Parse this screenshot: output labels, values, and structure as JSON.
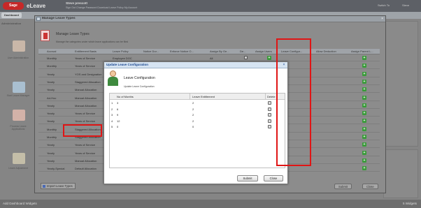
{
  "app": {
    "logo_text": "Sage",
    "brand": "eLeave",
    "user_name": "Steve prescott",
    "user_links": "Sign Out   Change Password   Download Leave Policy   My Account",
    "top_right_left": "Switch To",
    "top_right_right": "Steve"
  },
  "nav": {
    "dashboard": "Dashboard"
  },
  "sidebar": {
    "heading": "Administration",
    "items": [
      {
        "label": "User Administration"
      },
      {
        "label": "Start Leave Manager"
      },
      {
        "label": "Process Leave Applications"
      },
      {
        "label": "Leave Adjustment"
      }
    ]
  },
  "window": {
    "title": "Manage Leave Types",
    "heading": "Manage Leave Types",
    "subtitle": "Manage the categories under which leave applications can be filed",
    "columns": [
      "Accrual",
      "Entitlement Basis",
      "Leave Policy",
      "Notice Dur...",
      "Enforce Notice O...",
      "Assign By Ge...",
      "De...",
      "Assign Users",
      "Leave Configur...",
      "Allow Deduction",
      "Assign Parent L..."
    ],
    "rows": [
      {
        "accrual": "Monthly",
        "basis": "Years of Service",
        "policy": "Employee DOC",
        "gender": "All"
      },
      {
        "accrual": "Monthly",
        "basis": "Years of Service",
        "policy": "",
        "gender": ""
      },
      {
        "accrual": "Yearly",
        "basis": "YOS and Designation",
        "policy": "",
        "gender": ""
      },
      {
        "accrual": "Yearly",
        "basis": "Staggered Allocation",
        "policy": "",
        "gender": ""
      },
      {
        "accrual": "Yearly",
        "basis": "Manual Allocation",
        "policy": "",
        "gender": ""
      },
      {
        "accrual": "Ad-Hoc",
        "basis": "Manual Allocation",
        "policy": "",
        "gender": ""
      },
      {
        "accrual": "Yearly",
        "basis": "Manual Allocation",
        "policy": "",
        "gender": ""
      },
      {
        "accrual": "Yearly",
        "basis": "Years of Service",
        "policy": "",
        "gender": ""
      },
      {
        "accrual": "Yearly",
        "basis": "Years of Service",
        "policy": "",
        "gender": ""
      },
      {
        "accrual": "Monthly",
        "basis": "Staggered Allocation",
        "policy": "",
        "gender": ""
      },
      {
        "accrual": "Monthly",
        "basis": "Staggered Allocation",
        "policy": "",
        "gender": ""
      },
      {
        "accrual": "Yearly",
        "basis": "Years of Service",
        "policy": "",
        "gender": ""
      },
      {
        "accrual": "Yearly",
        "basis": "Years of Service",
        "policy": "",
        "gender": ""
      },
      {
        "accrual": "Yearly",
        "basis": "Manual Allocation",
        "policy": "",
        "gender": ""
      },
      {
        "accrual": "Yearly-Special",
        "basis": "Default Allocation",
        "policy": "",
        "gender": ""
      }
    ],
    "import_button": "Import Leave Types",
    "submit_button": "Submit",
    "close_button": "Close"
  },
  "dialog": {
    "title": "Update Leave Configuration",
    "heading": "Leave Configuration",
    "subtitle": "Update Leave Configuration",
    "columns": [
      "No of Months",
      "Leave Entitlement",
      "Delete"
    ],
    "rows": [
      {
        "n": "1",
        "months": "3",
        "entitlement": "2"
      },
      {
        "n": "2",
        "months": "6",
        "entitlement": "2"
      },
      {
        "n": "3",
        "months": "9",
        "entitlement": "2"
      },
      {
        "n": "4",
        "months": "12",
        "entitlement": "2"
      },
      {
        "n": "5",
        "months": "0",
        "entitlement": "0"
      }
    ],
    "submit_button": "Submit",
    "close_button": "Close"
  },
  "footer": {
    "left": "Add Dashboard Widgets",
    "right": "5 Widgets"
  },
  "colors": {
    "highlight": "#e01515",
    "accent": "#3a9a3a"
  }
}
